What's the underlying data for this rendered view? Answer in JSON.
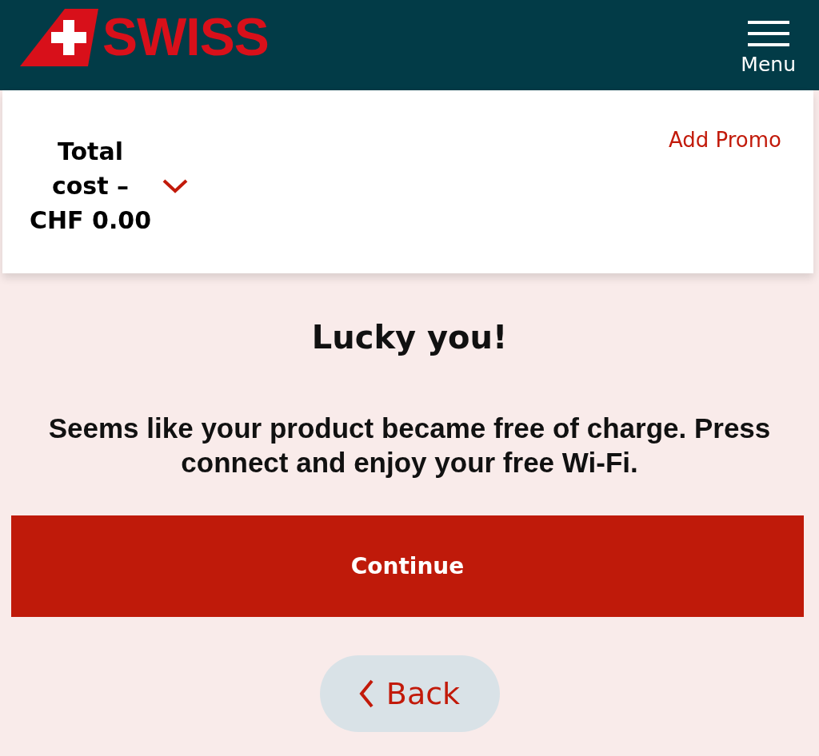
{
  "header": {
    "logo": {
      "wordmark": "SWISS"
    },
    "menu": {
      "label": "Menu"
    }
  },
  "summary": {
    "total": "Total cost – CHF 0.00",
    "expanded": false,
    "promo_link": "Add Promo"
  },
  "message": {
    "title": "Lucky you!",
    "body": "Seems like your product became free of charge. Press connect and enjoy your free Wi-Fi."
  },
  "actions": [
    {
      "kind": "primary",
      "label": "Continue"
    },
    {
      "kind": "back",
      "label": "Back"
    }
  ]
}
